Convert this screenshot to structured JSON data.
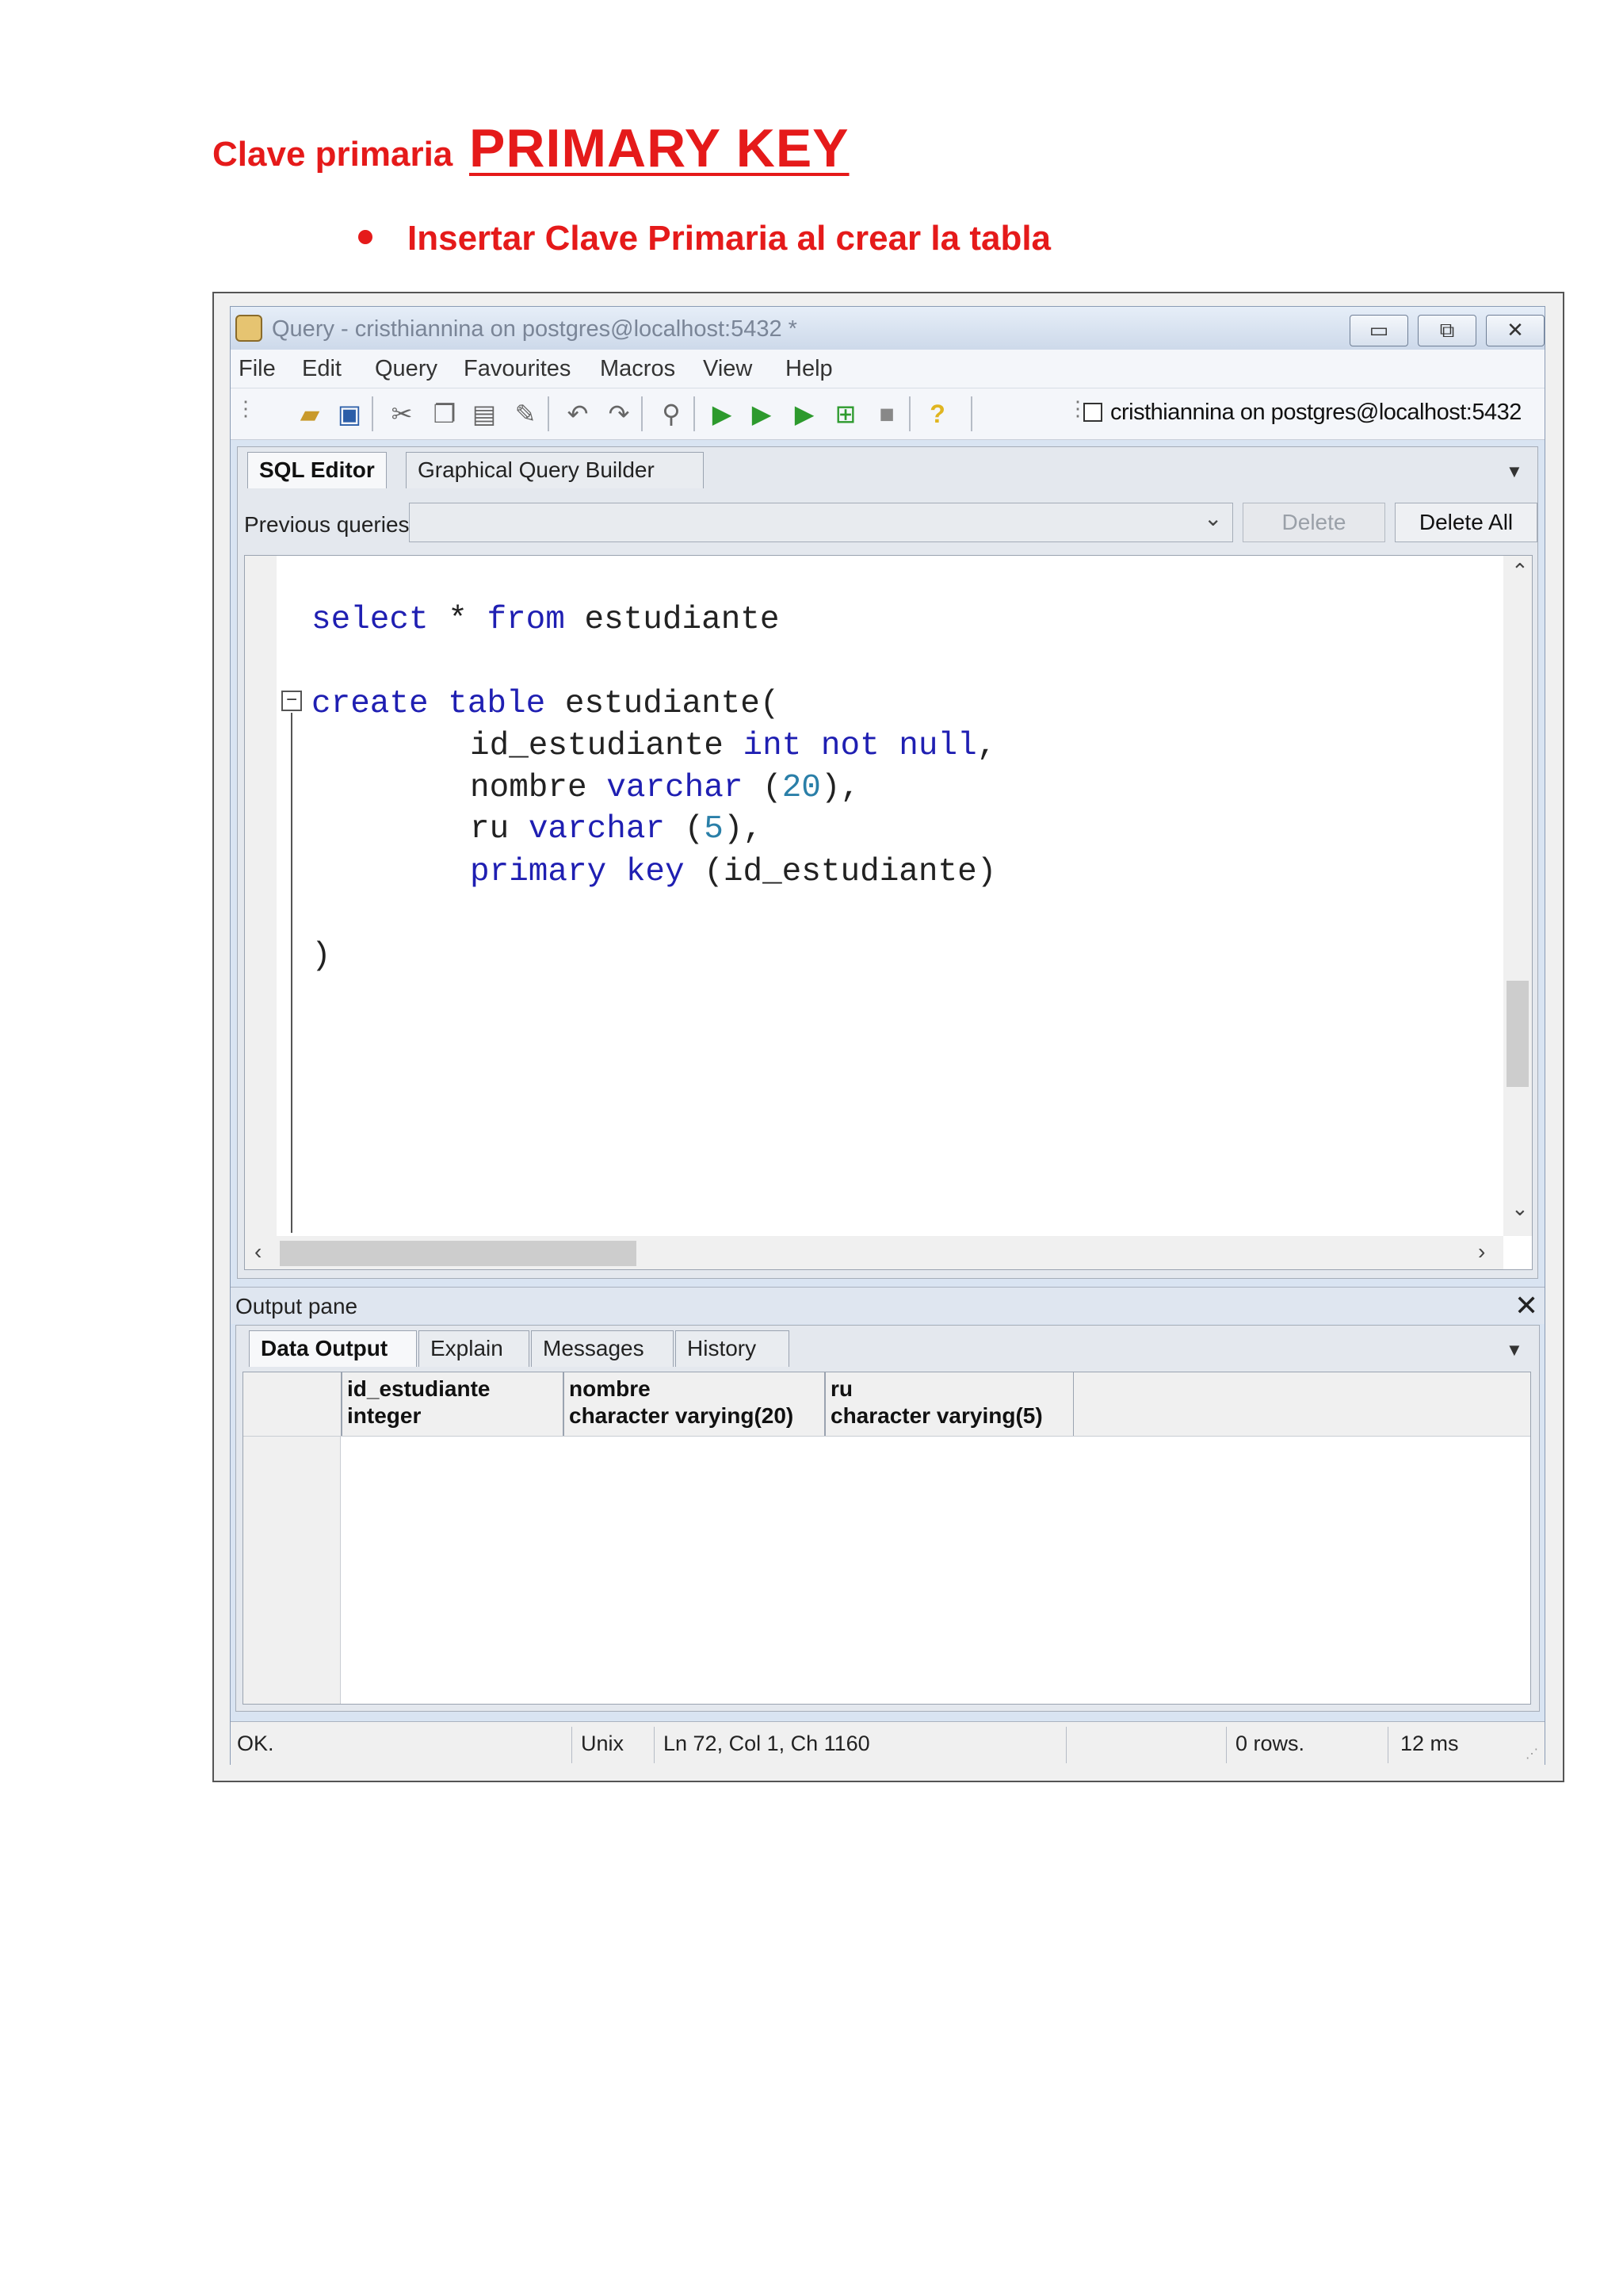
{
  "document": {
    "subtitle": "Clave primaria",
    "title": "PRIMARY  KEY",
    "bullet": "Insertar Clave Primaria al crear la tabla"
  },
  "window": {
    "title": "Query - cristhiannina on postgres@localhost:5432 *",
    "controls": {
      "minimize": "▭",
      "maximize": "⧉",
      "close": "✕"
    }
  },
  "menu": [
    "File",
    "Edit",
    "Query",
    "Favourites",
    "Macros",
    "View",
    "Help"
  ],
  "toolbar": {
    "icons": [
      "open-file-icon",
      "save-icon",
      "cut-icon",
      "copy-icon",
      "paste-icon",
      "clear-icon",
      "undo-icon",
      "redo-icon",
      "find-icon",
      "execute-icon",
      "execute-pgscript-icon",
      "execute-to-file-icon",
      "explain-icon",
      "cancel-icon",
      "help-icon"
    ],
    "connection": "cristhiannina on postgres@localhost:5432"
  },
  "editor_tabs": {
    "sql_editor": "SQL Editor",
    "graphical_query_builder": "Graphical Query Builder"
  },
  "previous_queries": {
    "label": "Previous queries",
    "value": "",
    "delete": "Delete",
    "delete_all": "Delete All"
  },
  "code": {
    "l1_kw1": "select",
    "l1_mid": " * ",
    "l1_kw2": "from",
    "l1_rest": " estudiante",
    "l2_kw": "create table",
    "l2_rest": " estudiante(",
    "l3_a": "id_estudiante ",
    "l3_kw": "int not null",
    "l3_b": ",",
    "l4_a": "nombre ",
    "l4_kw": "varchar",
    "l4_b": " (",
    "l4_num": "20",
    "l4_c": "),",
    "l5_a": "ru ",
    "l5_kw": "varchar",
    "l5_b": " (",
    "l5_num": "5",
    "l5_c": "),",
    "l6_kw": "primary key",
    "l6_b": " (id_estudiante)",
    "l7": ")"
  },
  "output": {
    "title": "Output pane",
    "tabs": {
      "data_output": "Data Output",
      "explain": "Explain",
      "messages": "Messages",
      "history": "History"
    },
    "columns": [
      {
        "name": "id_estudiante",
        "type": "integer"
      },
      {
        "name": "nombre",
        "type": "character varying(20)"
      },
      {
        "name": "ru",
        "type": "character varying(5)"
      }
    ]
  },
  "status": {
    "message": "OK.",
    "line_endings": "Unix",
    "position": "Ln 72, Col 1, Ch 1160",
    "rows": "0 rows.",
    "time": "12 ms"
  }
}
